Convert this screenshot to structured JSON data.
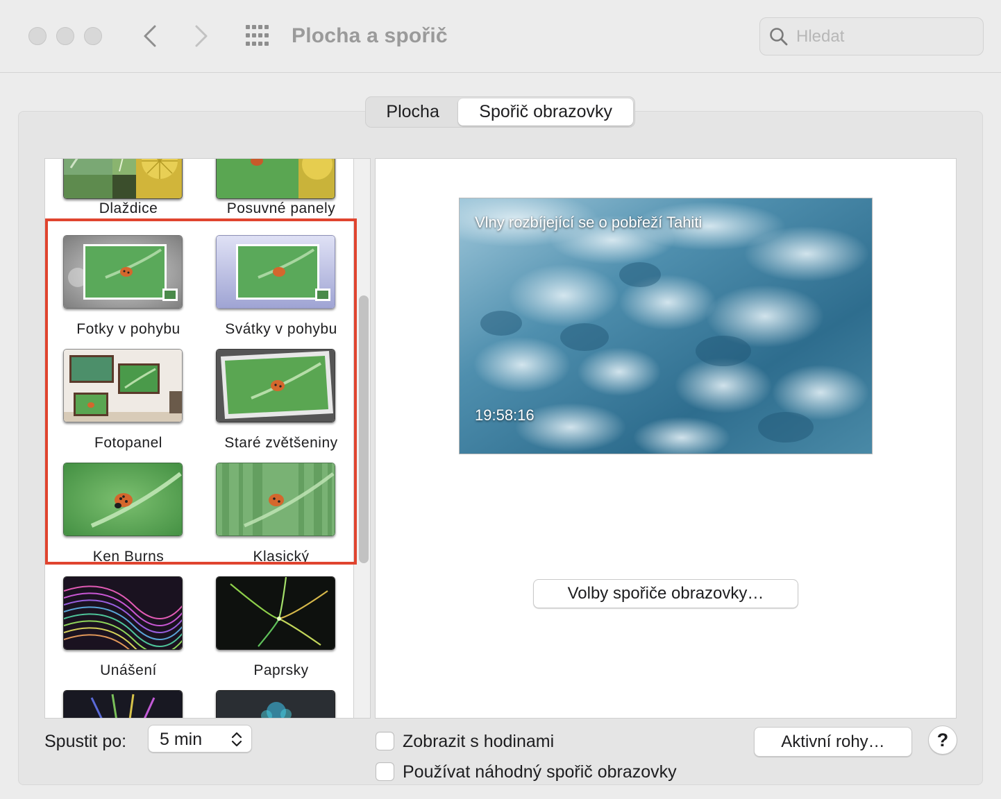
{
  "window": {
    "title": "Plocha a spořič",
    "search_placeholder": "Hledat"
  },
  "tabs": [
    {
      "label": "Plocha",
      "selected": false
    },
    {
      "label": "Spořič obrazovky",
      "selected": true
    }
  ],
  "screensavers": [
    {
      "label": "Dlaždice",
      "icon": "tiles-thumbnail"
    },
    {
      "label": "Posuvné panely",
      "icon": "sliding-panels-thumbnail"
    },
    {
      "label": "Fotky v pohybu",
      "icon": "floating-photos-thumbnail"
    },
    {
      "label": "Svátky v pohybu",
      "icon": "flipping-holiday-thumbnail"
    },
    {
      "label": "Fotopanel",
      "icon": "photo-wall-thumbnail"
    },
    {
      "label": "Staré zvětšeniny",
      "icon": "vintage-prints-thumbnail"
    },
    {
      "label": "Ken Burns",
      "icon": "ken-burns-thumbnail"
    },
    {
      "label": "Klasický",
      "icon": "classic-thumbnail"
    },
    {
      "label": "Unášení",
      "icon": "drift-thumbnail"
    },
    {
      "label": "Paprsky",
      "icon": "flurry-thumbnail"
    }
  ],
  "preview": {
    "title": "Vlny rozbíjející se o pobřeží Tahiti",
    "time": "19:58:16"
  },
  "options_button": "Volby spořiče obrazovky…",
  "start_after": {
    "label": "Spustit po:",
    "value": "5 min"
  },
  "checkboxes": [
    {
      "label": "Zobrazit s hodinami",
      "checked": false
    },
    {
      "label": "Používat náhodný spořič obrazovky",
      "checked": false
    }
  ],
  "hot_corners_button": "Aktivní rohy…",
  "help_button": "?",
  "colors": {
    "highlight": "#e0442f",
    "window_bg": "#ececec"
  }
}
